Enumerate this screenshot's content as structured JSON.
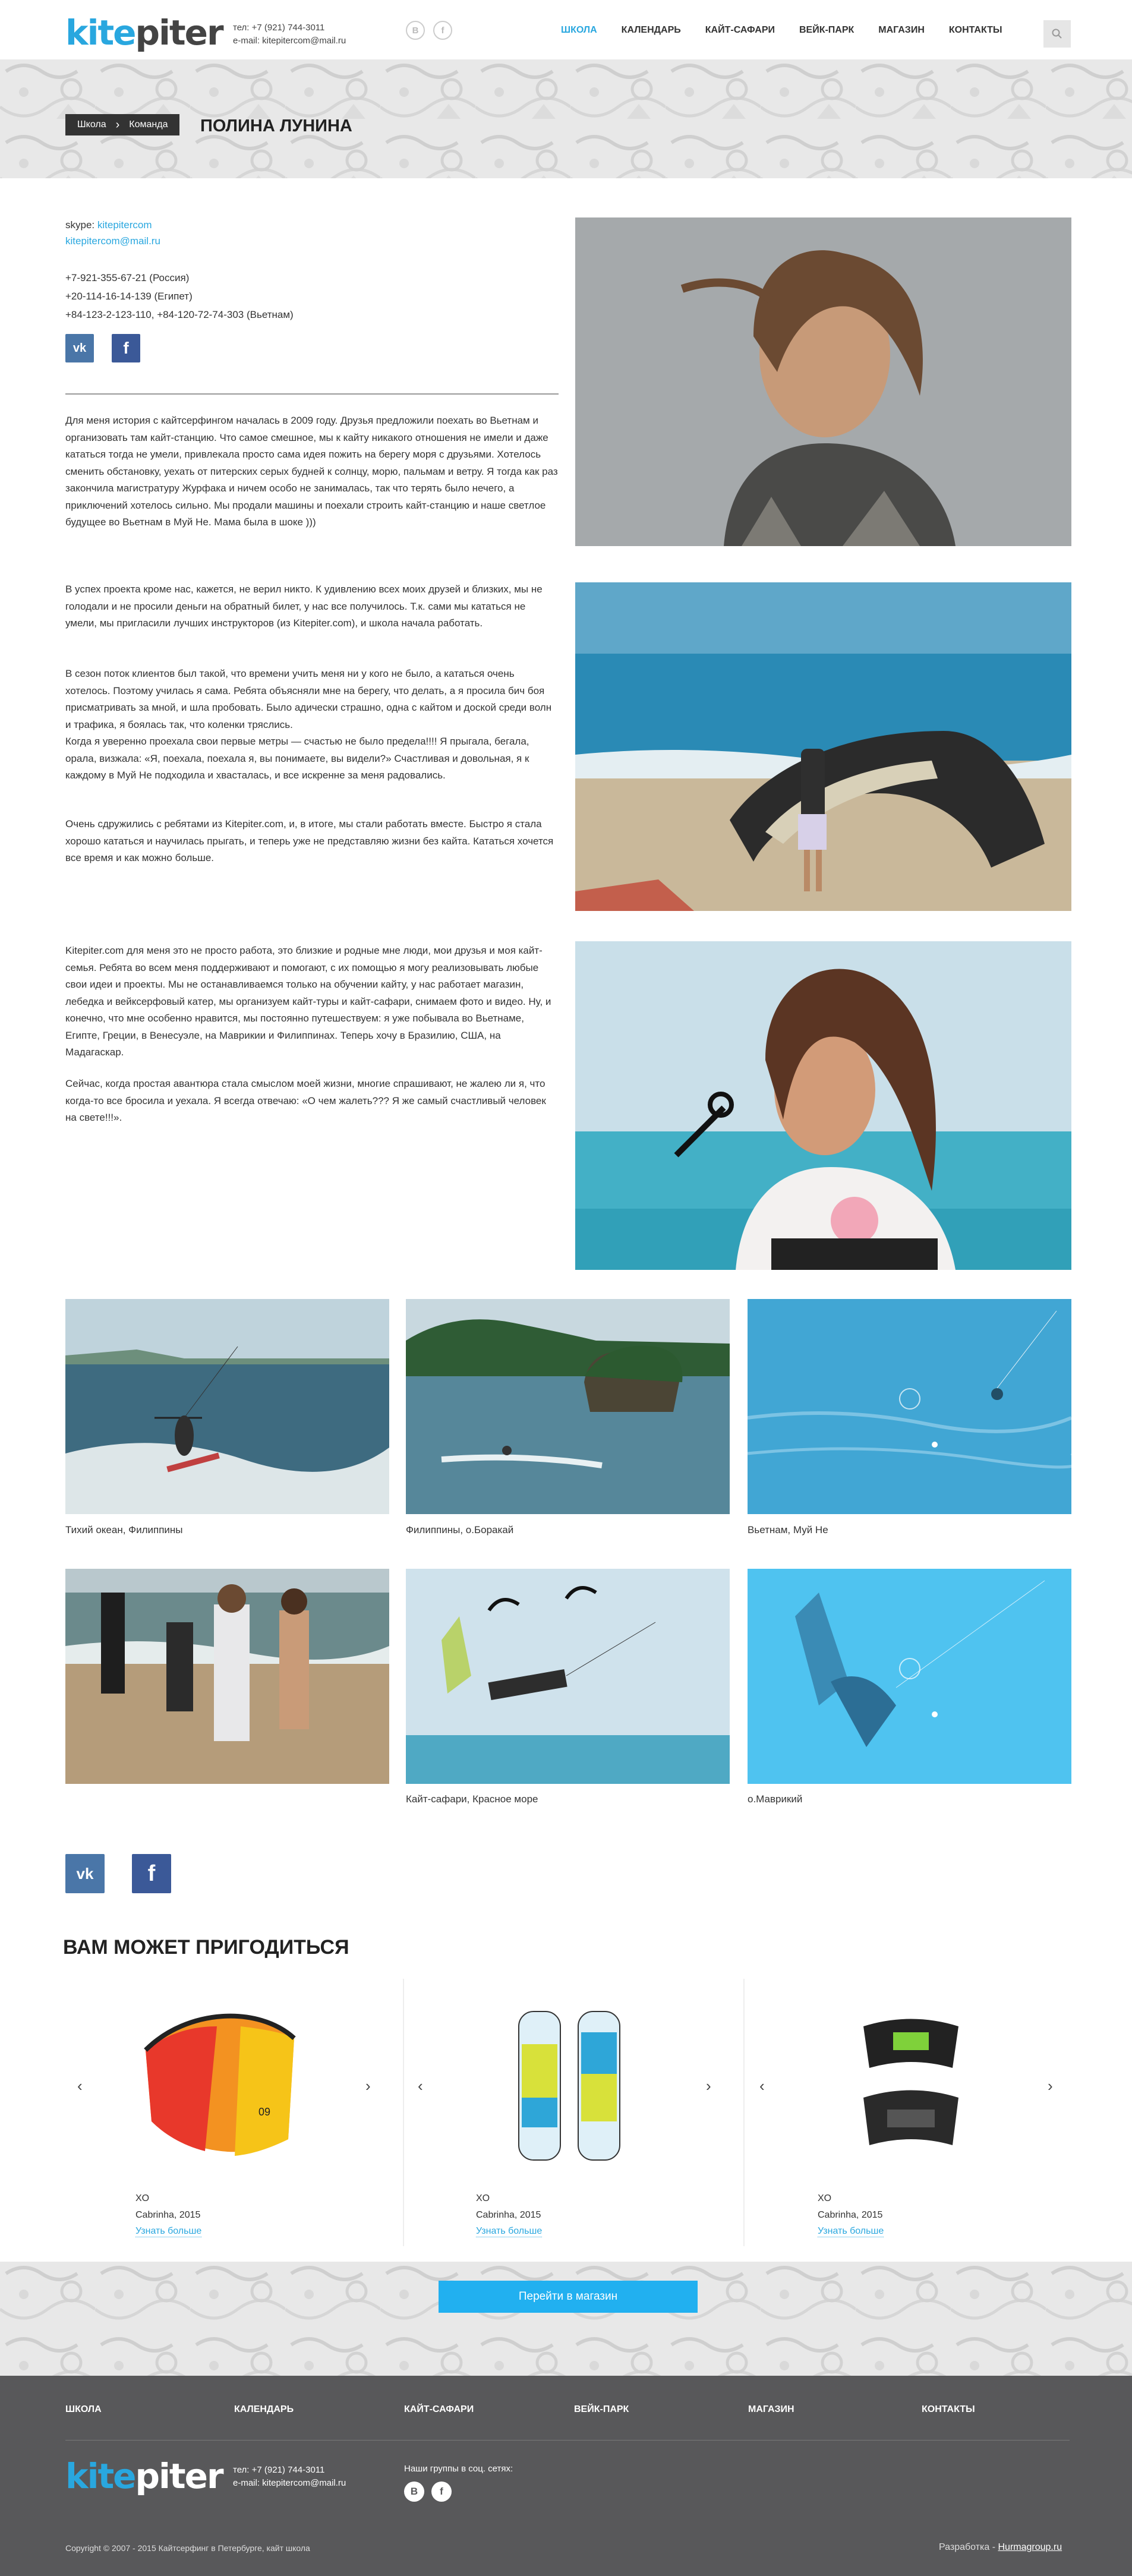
{
  "header": {
    "logo_kite": "kite",
    "logo_piter": "piter",
    "phone": "тел: +7 (921) 744-3011",
    "email": "e-mail: kitepitercom@mail.ru",
    "social": [
      "vk-circle",
      "facebook-circle"
    ],
    "nav": [
      "Школа",
      "Календарь",
      "Кайт-сафари",
      "Вейк-парк",
      "Магазин",
      "Контакты"
    ],
    "active_nav": "Школа",
    "search_icon": "search-icon"
  },
  "breadcrumbs": [
    "Школа",
    "Команда"
  ],
  "page_title": "Полина Лунина",
  "profile": {
    "skype_label": "skype: ",
    "skype": "kitepitercom",
    "email": "kitepitercom@mail.ru",
    "phones": [
      "+7-921-355-67-21  (Россия)",
      "+20-114-16-14-139  (Египет)",
      "+84-123-2-123-110,  +84-120-72-74-303  (Вьетнам)"
    ]
  },
  "story": [
    "Для меня история с кайтсерфингом началась в 2009 году. Друзья предложили поехать во Вьетнам и организовать там кайт-станцию. Что самое смешное, мы к кайту никакого отношения не имели и даже кататься тогда не умели, привлекала просто сама идея пожить на берегу моря с друзьями. Хотелось сменить обстановку, уехать от питерских серых будней к солнцу, морю, пальмам и ветру. Я тогда как раз закончила магистратуру Журфака и ничем особо не занималась, так что терять было нечего, а приключений хотелось сильно. Мы продали машины и поехали строить кайт-станцию и наше светлое будущее во Вьетнам в Муй Не. Мама была в шоке )))",
    "В успех проекта кроме нас, кажется, не верил никто. К удивлению всех моих друзей и близких, мы не голодали и не просили деньги на обратный билет, у нас все получилось. Т.к. сами мы кататься не умели, мы пригласили лучших инструкторов (из Kitepiter.com), и школа начала работать.",
    "В сезон поток клиентов был такой, что времени учить меня ни у кого не было, а кататься очень хотелось. Поэтому училась я сама. Ребята объясняли мне на берегу, что делать, а я просила бич боя присматривать за мной, и шла пробовать. Было адически страшно, одна с кайтом и доской среди волн и трафика, я боялась так, что коленки тряслись.\nКогда я уверенно проехала свои первые метры — счастью не было предела!!!! Я прыгала, бегала, орала, визжала: «Я, поехала, поехала я, вы понимаете, вы видели?» Счастливая и довольная, я к каждому в Муй Не подходила и хвасталась, и все искренне за меня радовались.",
    "Очень сдружились с ребятами из Kitepiter.com, и, в итоге, мы стали работать вместе. Быстро я стала хорошо кататься и научилась прыгать, и теперь уже не представляю жизни без кайта. Кататься хочется все время и как можно больше.",
    "Kitepiter.com для меня это не просто работа, это близкие и родные мне люди, мои друзья и моя кайт-семья. Ребята во всем меня поддерживают и помогают, с их помощью я могу реализовывать любые свои идеи и проекты. Мы не останавливаемся только на обучении кайту, у нас работает магазин, лебедка и вейксерфовый катер, мы организуем кайт-туры и кайт-сафари, снимаем фото и видео. Ну, и конечно, что мне особенно нравится, мы постоянно путешествуем: я уже побывала во Вьетнаме, Египте, Греции, в Венесуэле, на Маврикии и Филиппинах. Теперь хочу в Бразилию, США, на Мадагаскар.",
    "Сейчас, когда простая авантюра стала смыслом моей жизни, многие спрашивают, не жалею ли я, что когда-то все бросила и уехала. Я всегда отвечаю: «О чем жалеть??? Я же самый счастливый человек на свете!!!»."
  ],
  "gallery": [
    {
      "caption": "Тихий океан, Филиппины"
    },
    {
      "caption": "Филиппины, о.Боракай"
    },
    {
      "caption": "Вьетнам, Муй Не"
    },
    {
      "caption": ""
    },
    {
      "caption": "Кайт-сафари, Красное море"
    },
    {
      "caption": "о.Маврикий"
    }
  ],
  "recommend": {
    "title": "Вам может пригодиться",
    "items": [
      {
        "name": "XO",
        "sub": "Cabrinha, 2015",
        "link": "Узнать больше",
        "kind": "kite"
      },
      {
        "name": "XO",
        "sub": "Cabrinha, 2015",
        "link": "Узнать больше",
        "kind": "boards"
      },
      {
        "name": "XO",
        "sub": "Cabrinha, 2015",
        "link": "Узнать больше",
        "kind": "harness"
      }
    ],
    "shop_button": "Перейти в магазин"
  },
  "footer": {
    "nav": [
      "Школа",
      "Календарь",
      "Кайт-сафари",
      "Вейк-парк",
      "Магазин",
      "Контакты"
    ],
    "phone": "тел: +7 (921) 744-3011",
    "email": "e-mail: kitepitercom@mail.ru",
    "social_label": "Наши группы в соц. сетях:",
    "copyright": "Copyright © 2007 - 2015 Кайтсерфинг в Петербурге, кайт школа",
    "dev_label": "Разработка - ",
    "dev_link": "Hurmagroup.ru"
  },
  "colors": {
    "accent": "#29a7df",
    "button": "#21b0f0",
    "footer": "#58585a",
    "dark": "#333333"
  }
}
